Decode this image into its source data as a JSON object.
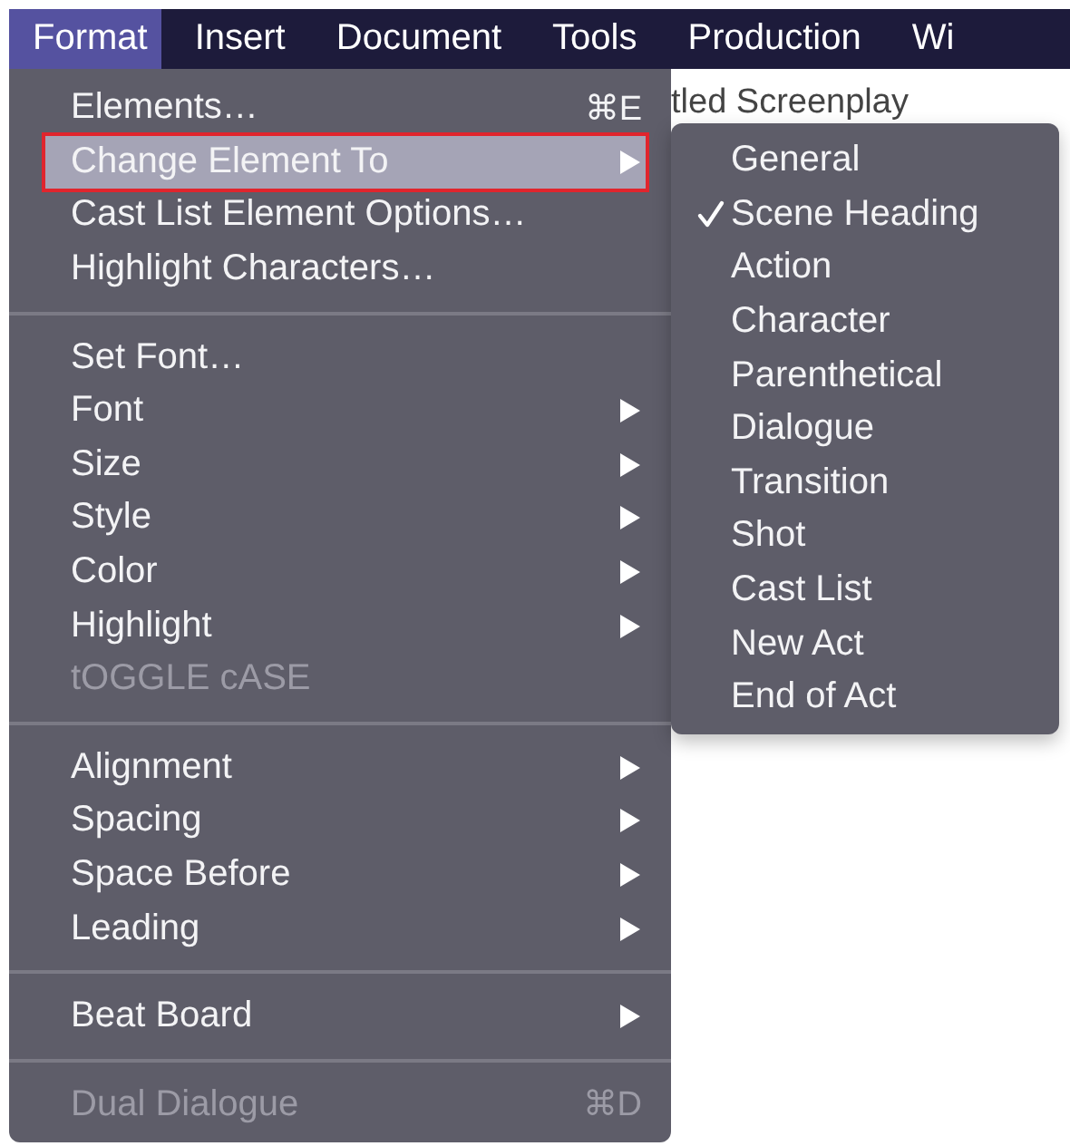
{
  "menu_bar": {
    "items": [
      {
        "label": "Format",
        "selected": true
      },
      {
        "label": "Insert",
        "selected": false
      },
      {
        "label": "Document",
        "selected": false
      },
      {
        "label": "Tools",
        "selected": false
      },
      {
        "label": "Production",
        "selected": false
      },
      {
        "label": "Wi",
        "selected": false
      }
    ]
  },
  "document": {
    "title": "tled Screenplay"
  },
  "menu": {
    "items": [
      {
        "kind": "item",
        "label": "Elements…",
        "shortcut": "⌘E",
        "submenu": false,
        "disabled": false,
        "selected": false
      },
      {
        "kind": "item",
        "label": "Change Element To",
        "submenu": true,
        "disabled": false,
        "selected": true
      },
      {
        "kind": "item",
        "label": "Cast List Element Options…",
        "submenu": false,
        "disabled": false,
        "selected": false
      },
      {
        "kind": "item",
        "label": "Highlight Characters…",
        "submenu": false,
        "disabled": false,
        "selected": false
      },
      {
        "kind": "separator"
      },
      {
        "kind": "item",
        "label": "Set Font…",
        "submenu": false,
        "disabled": false,
        "selected": false
      },
      {
        "kind": "item",
        "label": "Font",
        "submenu": true,
        "disabled": false,
        "selected": false
      },
      {
        "kind": "item",
        "label": "Size",
        "submenu": true,
        "disabled": false,
        "selected": false
      },
      {
        "kind": "item",
        "label": "Style",
        "submenu": true,
        "disabled": false,
        "selected": false
      },
      {
        "kind": "item",
        "label": "Color",
        "submenu": true,
        "disabled": false,
        "selected": false
      },
      {
        "kind": "item",
        "label": "Highlight",
        "submenu": true,
        "disabled": false,
        "selected": false
      },
      {
        "kind": "item",
        "label": "tOGGLE cASE",
        "submenu": false,
        "disabled": true,
        "selected": false
      },
      {
        "kind": "separator"
      },
      {
        "kind": "item",
        "label": "Alignment",
        "submenu": true,
        "disabled": false,
        "selected": false
      },
      {
        "kind": "item",
        "label": "Spacing",
        "submenu": true,
        "disabled": false,
        "selected": false
      },
      {
        "kind": "item",
        "label": "Space Before",
        "submenu": true,
        "disabled": false,
        "selected": false
      },
      {
        "kind": "item",
        "label": "Leading",
        "submenu": true,
        "disabled": false,
        "selected": false
      },
      {
        "kind": "separator"
      },
      {
        "kind": "item",
        "label": "Beat Board",
        "submenu": true,
        "disabled": false,
        "selected": false
      },
      {
        "kind": "separator"
      },
      {
        "kind": "item",
        "label": "Dual Dialogue",
        "shortcut": "⌘D",
        "submenu": false,
        "disabled": true,
        "selected": false
      }
    ]
  },
  "submenu": {
    "items": [
      {
        "label": "General",
        "checked": false
      },
      {
        "label": "Scene Heading",
        "checked": true
      },
      {
        "label": "Action",
        "checked": false
      },
      {
        "label": "Character",
        "checked": false
      },
      {
        "label": "Parenthetical",
        "checked": false
      },
      {
        "label": "Dialogue",
        "checked": false
      },
      {
        "label": "Transition",
        "checked": false
      },
      {
        "label": "Shot",
        "checked": false
      },
      {
        "label": "Cast List",
        "checked": false
      },
      {
        "label": "New Act",
        "checked": false
      },
      {
        "label": "End of Act",
        "checked": false
      }
    ]
  }
}
